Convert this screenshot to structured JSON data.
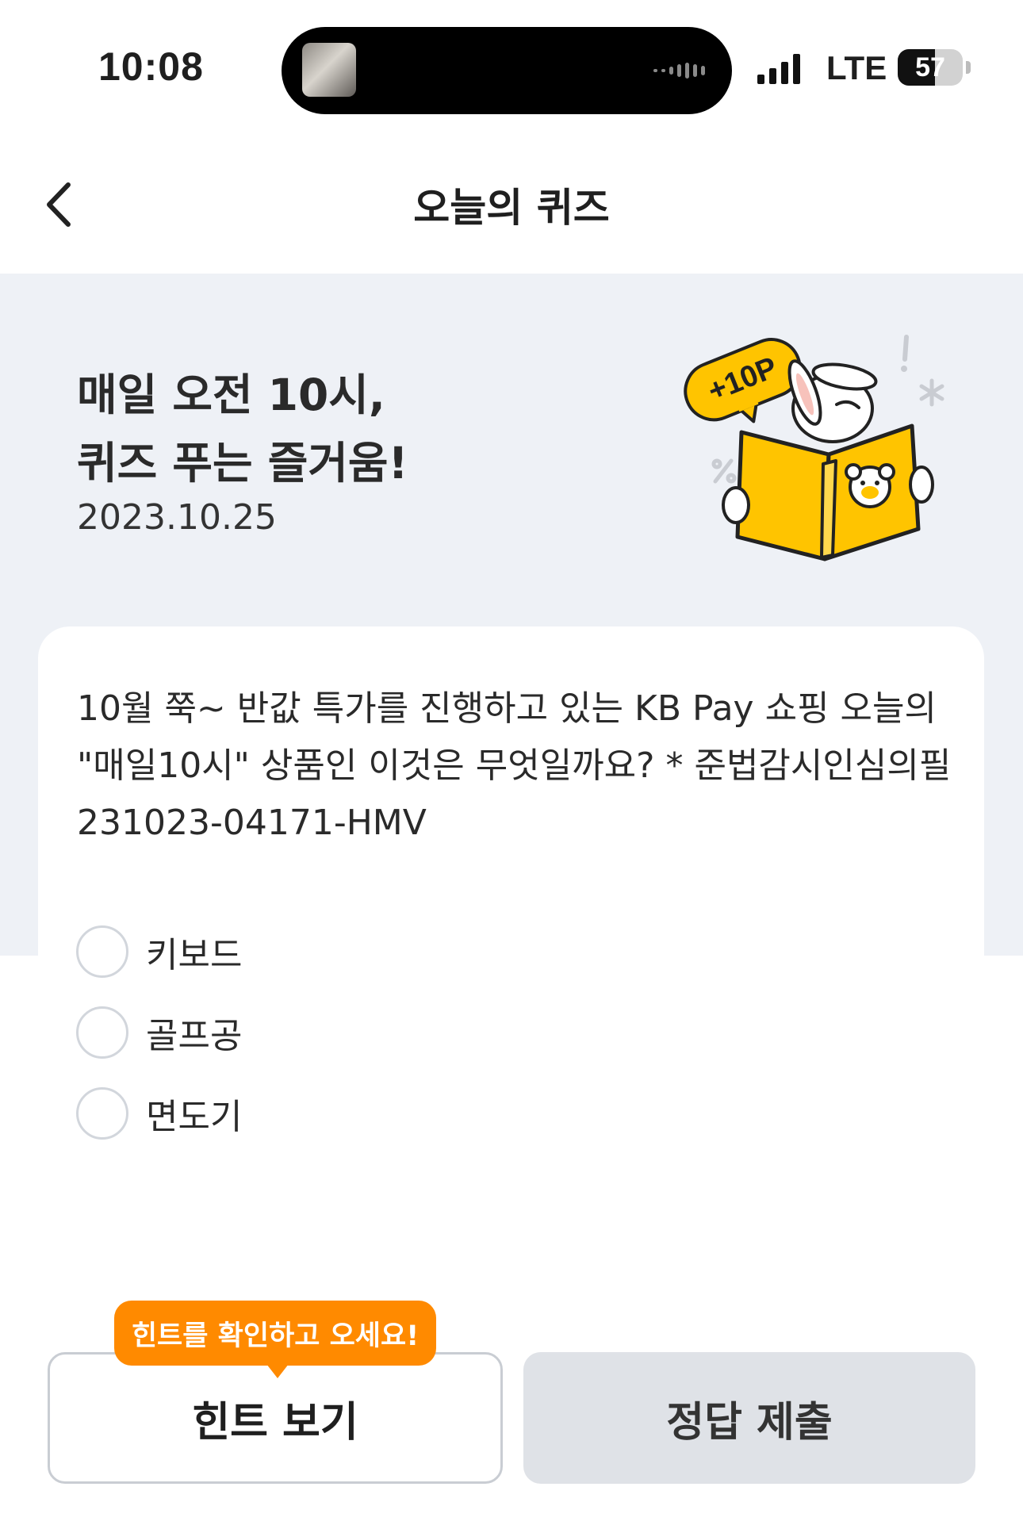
{
  "status_bar": {
    "time": "10:08",
    "network": "LTE",
    "battery_level": "57",
    "battery_fraction": 0.57,
    "island_thumb_icon": "music-album-thumbnail"
  },
  "nav": {
    "back_icon": "chevron-left-icon",
    "title": "오늘의 퀴즈"
  },
  "hero": {
    "title": "매일 오전 10시,\n퀴즈 푸는 즐거움!",
    "date": "2023.10.25",
    "badge": "+10P"
  },
  "quiz": {
    "question": "10월 쭉~ 반값 특가를 진행하고 있는 KB Pay 쇼핑 오늘의 \"매일10시\" 상품인 이것은 무엇일까요? * 준법감시인심의필231023-04171-HMV",
    "options": [
      "키보드",
      "골프공",
      "면도기"
    ]
  },
  "actions": {
    "tooltip": "힌트를 확인하고 오세요!",
    "hint_label": "힌트 보기",
    "submit_label": "정답 제출"
  },
  "colors": {
    "hero_bg": "#eef1f6",
    "accent_orange": "#ff8a00",
    "book_yellow": "#ffc400",
    "submit_bg": "#dfe2e7"
  }
}
